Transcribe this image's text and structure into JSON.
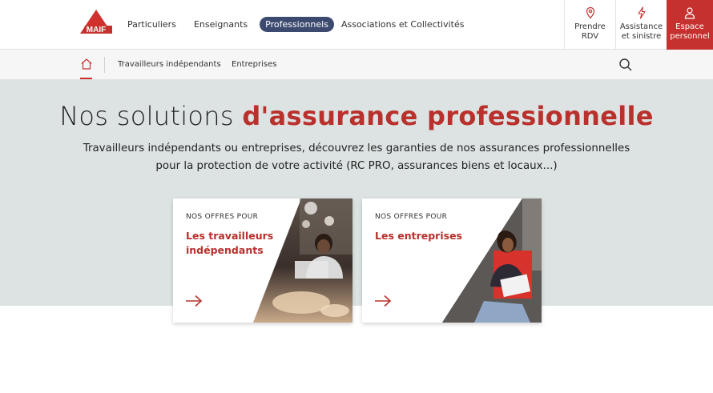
{
  "brand": {
    "logo_text": "MAIF",
    "accent": "#c4312e",
    "nav_active_bg": "#3d4a70",
    "hero_bg": "#dce3e2"
  },
  "nav": {
    "items": [
      {
        "label": "Particuliers"
      },
      {
        "label": "Enseignants"
      },
      {
        "label": "Professionnels",
        "active": true
      },
      {
        "label": "Associations et Collectivités"
      }
    ]
  },
  "actions": {
    "rdv": {
      "line1": "Prendre",
      "line2": "RDV",
      "icon": "location-pin-icon"
    },
    "assistance": {
      "line1": "Assistance",
      "line2": "et sinistre",
      "icon": "lightning-icon"
    },
    "espace": {
      "line1": "Espace",
      "line2": "personnel",
      "icon": "user-icon"
    }
  },
  "subnav": {
    "home_icon": "home-icon",
    "links": [
      {
        "label": "Travailleurs indépendants"
      },
      {
        "label": "Entreprises"
      }
    ],
    "search_icon": "search-icon"
  },
  "hero": {
    "title_plain": "Nos solutions ",
    "title_strong": "d'assurance professionnelle",
    "subtitle_line1": "Travailleurs indépendants ou entreprises, découvrez les garanties de nos assurances professionnelles",
    "subtitle_line2": "pour la protection de votre activité (RC PRO, assurances biens et locaux...)"
  },
  "cards": [
    {
      "kicker": "NOS OFFRES POUR",
      "title": "Les travailleurs indépendants",
      "icon": "arrow-right-icon"
    },
    {
      "kicker": "NOS OFFRES POUR",
      "title": "Les entreprises",
      "icon": "arrow-right-icon"
    }
  ]
}
